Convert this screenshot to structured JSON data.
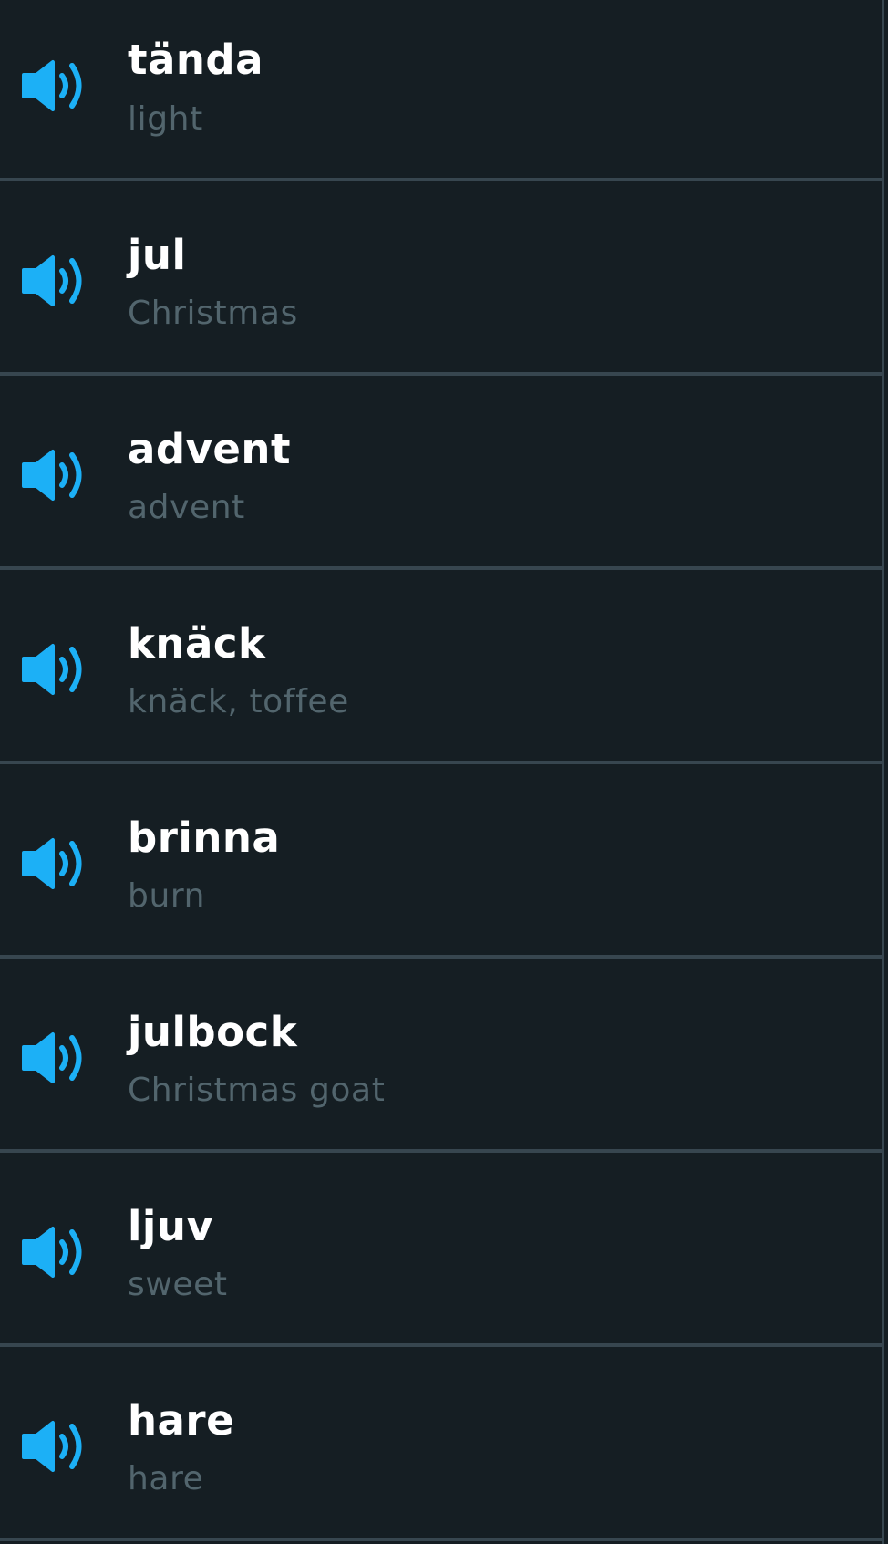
{
  "icons": {
    "speaker": "speaker-volume-icon",
    "speaker_color": "#1cb0f6"
  },
  "words": [
    {
      "word": "tända",
      "translation": "light"
    },
    {
      "word": "jul",
      "translation": "Christmas"
    },
    {
      "word": "advent",
      "translation": "advent"
    },
    {
      "word": "knäck",
      "translation": "knäck, toffee"
    },
    {
      "word": "brinna",
      "translation": "burn"
    },
    {
      "word": "julbock",
      "translation": "Christmas goat"
    },
    {
      "word": "ljuv",
      "translation": "sweet"
    },
    {
      "word": "hare",
      "translation": "hare"
    }
  ]
}
